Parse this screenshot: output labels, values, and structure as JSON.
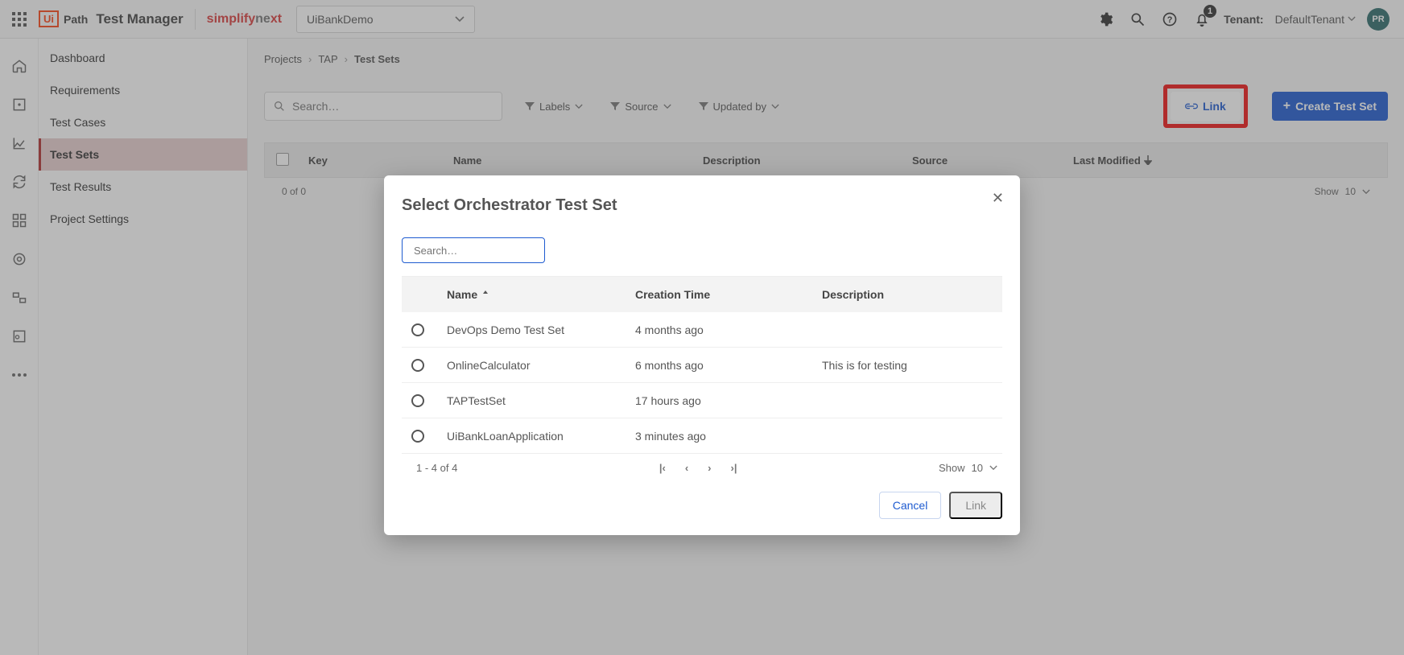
{
  "header": {
    "uipath_box": "Ui",
    "path_text": "Path",
    "app_name": "Test Manager",
    "partner_s0": "simplify",
    "partner_s1": "ne",
    "partner_s2": "xt",
    "project_selected": "UiBankDemo",
    "bell_count": "1",
    "tenant_label": "Tenant:",
    "tenant_value": "DefaultTenant",
    "avatar_initials": "PR"
  },
  "sidebar": {
    "items": [
      {
        "label": "Dashboard"
      },
      {
        "label": "Requirements"
      },
      {
        "label": "Test Cases"
      },
      {
        "label": "Test Sets"
      },
      {
        "label": "Test Results"
      },
      {
        "label": "Project Settings"
      }
    ]
  },
  "breadcrumb": {
    "a0": "Projects",
    "a1": "TAP",
    "current": "Test Sets"
  },
  "toolbar": {
    "search_placeholder": "Search…",
    "filter_labels": "Labels",
    "filter_source": "Source",
    "filter_updated": "Updated by",
    "link_label": "Link",
    "create_label": "Create Test Set"
  },
  "table": {
    "headers": {
      "key": "Key",
      "name": "Name",
      "description": "Description",
      "source": "Source",
      "last_modified": "Last Modified"
    },
    "count_text": "0 of 0",
    "show_label": "Show",
    "show_value": "10"
  },
  "modal": {
    "title": "Select Orchestrator Test Set",
    "search_placeholder": "Search…",
    "headers": {
      "name": "Name",
      "creation_time": "Creation Time",
      "description": "Description"
    },
    "rows": [
      {
        "name": "DevOps Demo Test Set",
        "creation_time": "4 months ago",
        "description": ""
      },
      {
        "name": "OnlineCalculator",
        "creation_time": "6 months ago",
        "description": "This is for testing"
      },
      {
        "name": "TAPTestSet",
        "creation_time": "17 hours ago",
        "description": ""
      },
      {
        "name": "UiBankLoanApplication",
        "creation_time": "3 minutes ago",
        "description": ""
      }
    ],
    "pager_text": "1 - 4 of 4",
    "show_label": "Show",
    "show_value": "10",
    "cancel_label": "Cancel",
    "link_label": "Link"
  }
}
